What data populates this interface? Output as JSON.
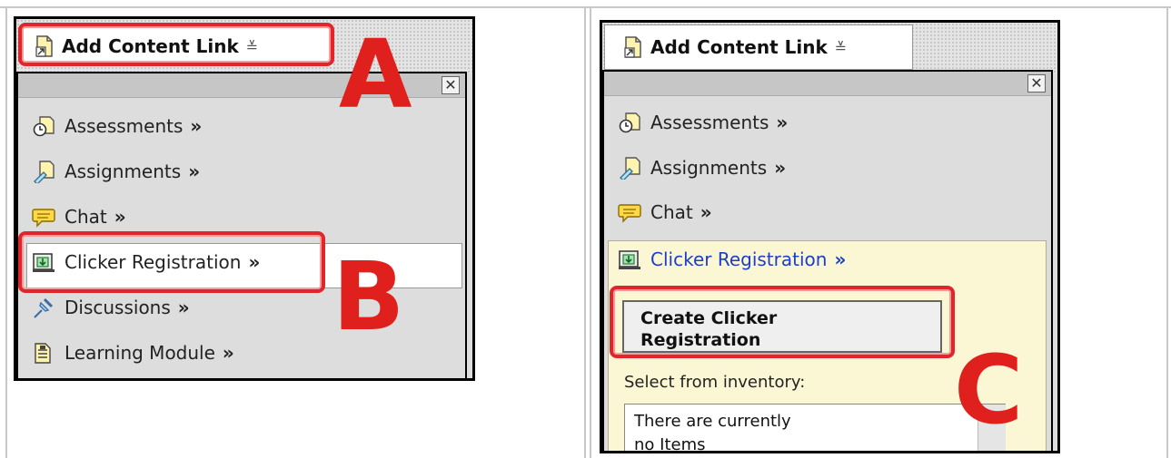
{
  "left_panel": {
    "toolbar_label": "Add Content Link",
    "annotation": "A",
    "menu_items": [
      {
        "label": "Assessments",
        "icon": "assessments-icon"
      },
      {
        "label": "Assignments",
        "icon": "assignments-icon"
      },
      {
        "label": "Chat",
        "icon": "chat-icon"
      },
      {
        "label": "Clicker Registration",
        "icon": "clicker-icon"
      },
      {
        "label": "Discussions",
        "icon": "discussions-icon"
      },
      {
        "label": "Learning Module",
        "icon": "learning-module-icon"
      }
    ],
    "highlight_annotation": "B"
  },
  "right_panel": {
    "toolbar_label": "Add Content Link",
    "menu_items": [
      {
        "label": "Assessments"
      },
      {
        "label": "Assignments"
      },
      {
        "label": "Chat"
      },
      {
        "label": "Clicker Registration"
      }
    ],
    "create_button_line1": "Create Clicker",
    "create_button_line2": "Registration",
    "annotation": "C",
    "select_label": "Select from inventory:",
    "inventory_line1": "There are currently",
    "inventory_line2": "no Items"
  },
  "common": {
    "more_glyph": "»",
    "close_glyph": "✕",
    "chevron_glyph": "≚"
  }
}
